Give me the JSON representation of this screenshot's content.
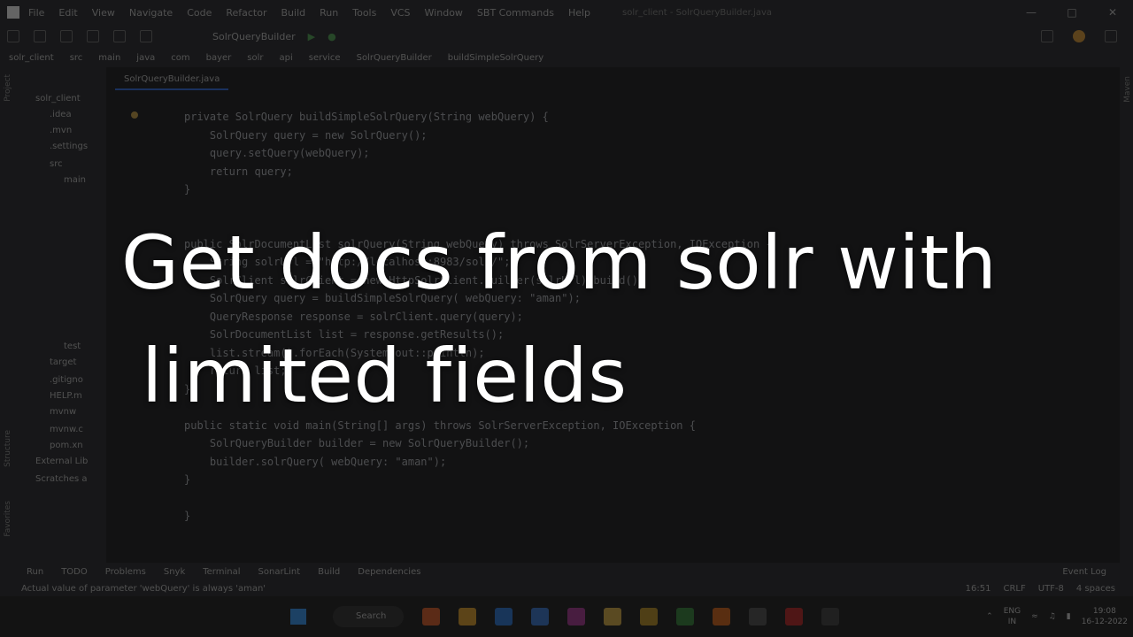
{
  "menubar": {
    "items": [
      "File",
      "Edit",
      "View",
      "Navigate",
      "Code",
      "Refactor",
      "Build",
      "Run",
      "Tools",
      "VCS",
      "Window",
      "SBT Commands",
      "Help"
    ],
    "window_title": "solr_client - SolrQueryBuilder.java"
  },
  "toolbar": {
    "run_config": "SolrQueryBuilder"
  },
  "breadcrumbs": [
    "solr_client",
    "src",
    "main",
    "java",
    "com",
    "bayer",
    "solr",
    "api",
    "service",
    "SolrQueryBuilder",
    "buildSimpleSolrQuery"
  ],
  "project_tree": [
    "solr_client",
    ".idea",
    ".mvn",
    ".settings",
    "src",
    "main",
    "test",
    "target",
    ".gitigno",
    "HELP.m",
    "mvnw",
    "mvnw.c",
    "pom.xn",
    "External Lib",
    "Scratches a"
  ],
  "editor": {
    "tab_label": "SolrQueryBuilder.java",
    "code_lines": [
      "private SolrQuery buildSimpleSolrQuery(String webQuery) {",
      "    SolrQuery query = new SolrQuery();",
      "    query.setQuery(webQuery);",
      "    return query;",
      "}",
      "",
      "",
      "public SolrDocumentList solrQuery(String webQuery) throws SolrServerException, IOException {",
      "    String solrUrl = \"http://localhost:8983/solr/\";",
      "    SolrClient solrClient = new HttpSolrClient.Builder(solrUrl).build();",
      "    SolrQuery query = buildSimpleSolrQuery( webQuery: \"aman\");",
      "    QueryResponse response = solrClient.query(query);",
      "    SolrDocumentList list = response.getResults();",
      "    list.stream().forEach(System.out::println);",
      "    return list;",
      "}",
      "",
      "public static void main(String[] args) throws SolrServerException, IOException {",
      "    SolrQueryBuilder builder = new SolrQueryBuilder();",
      "    builder.solrQuery( webQuery: \"aman\");",
      "}",
      "",
      "}"
    ]
  },
  "tool_windows": [
    "Run",
    "TODO",
    "Problems",
    "Snyk",
    "Terminal",
    "SonarLint",
    "Build",
    "Dependencies"
  ],
  "event_log_label": "Event Log",
  "status": {
    "message": "Actual value of parameter 'webQuery' is always 'aman'",
    "position": "16:51",
    "line_ending": "CRLF",
    "encoding": "UTF-8",
    "indent": "4 spaces"
  },
  "taskbar": {
    "search_label": "Search",
    "language": "ENG",
    "region": "IN",
    "time": "19:08",
    "date": "16-12-2022"
  },
  "caption": {
    "line1": "Get docs from solr with",
    "line2": "limited fields"
  },
  "colors": {
    "accent": "#3574f0",
    "caption_text": "#ffffff"
  }
}
